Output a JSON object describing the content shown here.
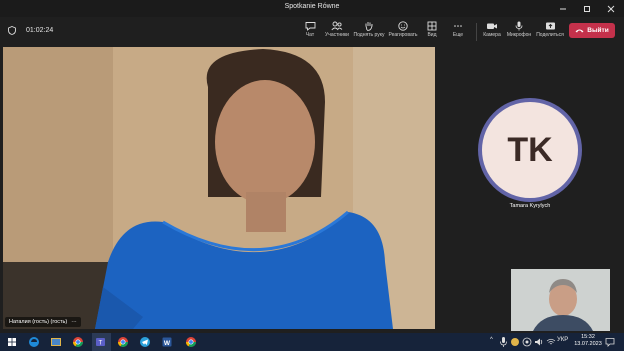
{
  "window": {
    "title": "Spotkanie Równe"
  },
  "meeting": {
    "timer": "01:02:24"
  },
  "toolbar": {
    "chat": "Чат",
    "participants": "Участники",
    "raise_hand": "Поднять руку",
    "react": "Реагировать",
    "view": "Вид",
    "more": "Еще",
    "camera": "Камера",
    "mic": "Микрофон",
    "share": "Поделиться",
    "leave": "Выйти"
  },
  "participants": {
    "main_name": "Наталия (гость) (гость)",
    "more_glyph": "···",
    "avatar_initials": "TK",
    "avatar_name": "Tamara Kyrylych"
  },
  "taskbar": {
    "lang": "УКР",
    "time": "15:32",
    "date": "13.07.2023"
  },
  "colors": {
    "leave": "#c4314b",
    "avatar_ring": "#6264a7",
    "avatar_bg": "#f3e4df",
    "taskbar": "#16233a"
  }
}
